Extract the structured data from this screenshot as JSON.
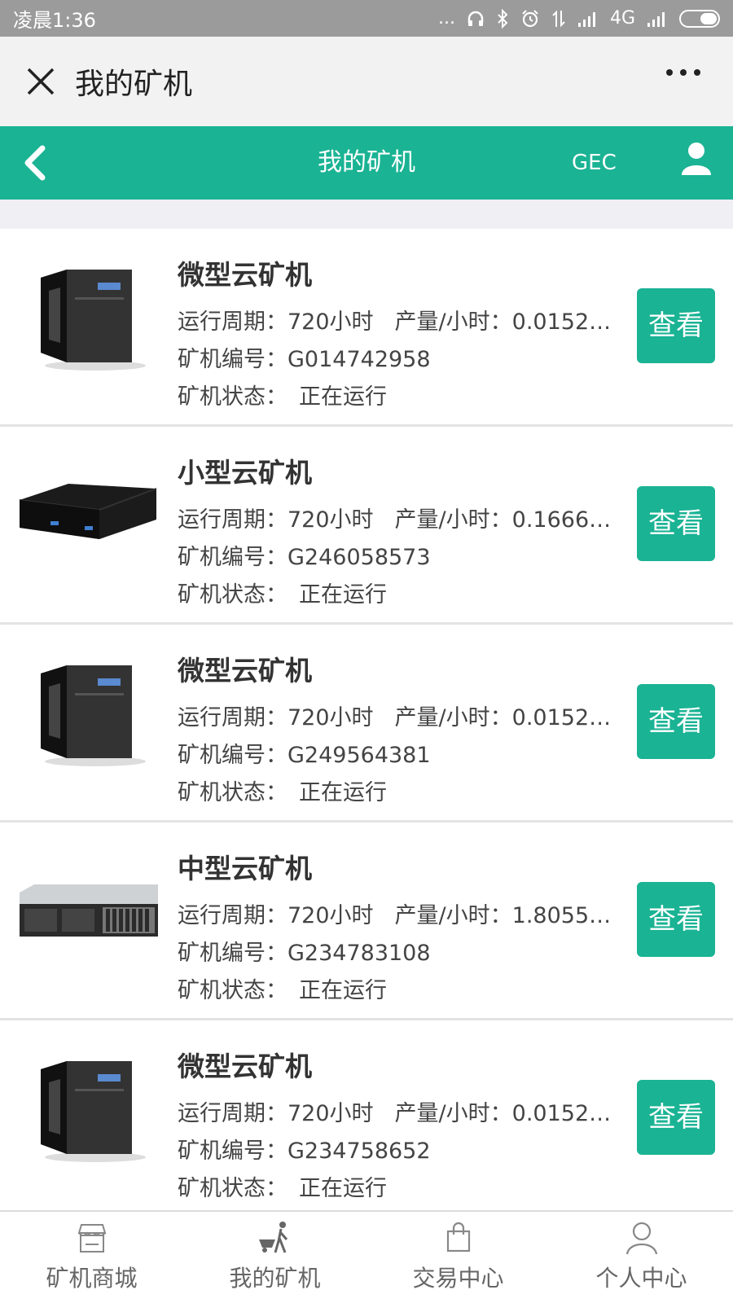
{
  "status_bar": {
    "time": "凌晨1:36",
    "dots": "...",
    "network": "4G"
  },
  "wechat_bar": {
    "title": "我的矿机"
  },
  "header": {
    "title": "我的矿机",
    "gec": "GEC",
    "accent_color": "#1ab394"
  },
  "labels": {
    "cycle": "运行周期：",
    "output": "产量/小时：",
    "number": "矿机编号：",
    "status": "矿机状态："
  },
  "miners": [
    {
      "name": "微型云矿机",
      "type": "tower",
      "cycle": "720小时",
      "output": "0.01527...",
      "number": "G014742958",
      "status": "正在运行",
      "button": "查看"
    },
    {
      "name": "小型云矿机",
      "type": "flat",
      "cycle": "720小时",
      "output": "0.16666...",
      "number": "G246058573",
      "status": "正在运行",
      "button": "查看"
    },
    {
      "name": "微型云矿机",
      "type": "tower",
      "cycle": "720小时",
      "output": "0.01527...",
      "number": "G249564381",
      "status": "正在运行",
      "button": "查看"
    },
    {
      "name": "中型云矿机",
      "type": "rack",
      "cycle": "720小时",
      "output": "1.80555...",
      "number": "G234783108",
      "status": "正在运行",
      "button": "查看"
    },
    {
      "name": "微型云矿机",
      "type": "tower",
      "cycle": "720小时",
      "output": "0.01527...",
      "number": "G234758652",
      "status": "正在运行",
      "button": "查看"
    }
  ],
  "bottom_nav": [
    {
      "label": "矿机商城",
      "icon": "store-icon"
    },
    {
      "label": "我的矿机",
      "icon": "miner-worker-icon"
    },
    {
      "label": "交易中心",
      "icon": "shopping-bag-icon"
    },
    {
      "label": "个人中心",
      "icon": "person-icon"
    }
  ]
}
